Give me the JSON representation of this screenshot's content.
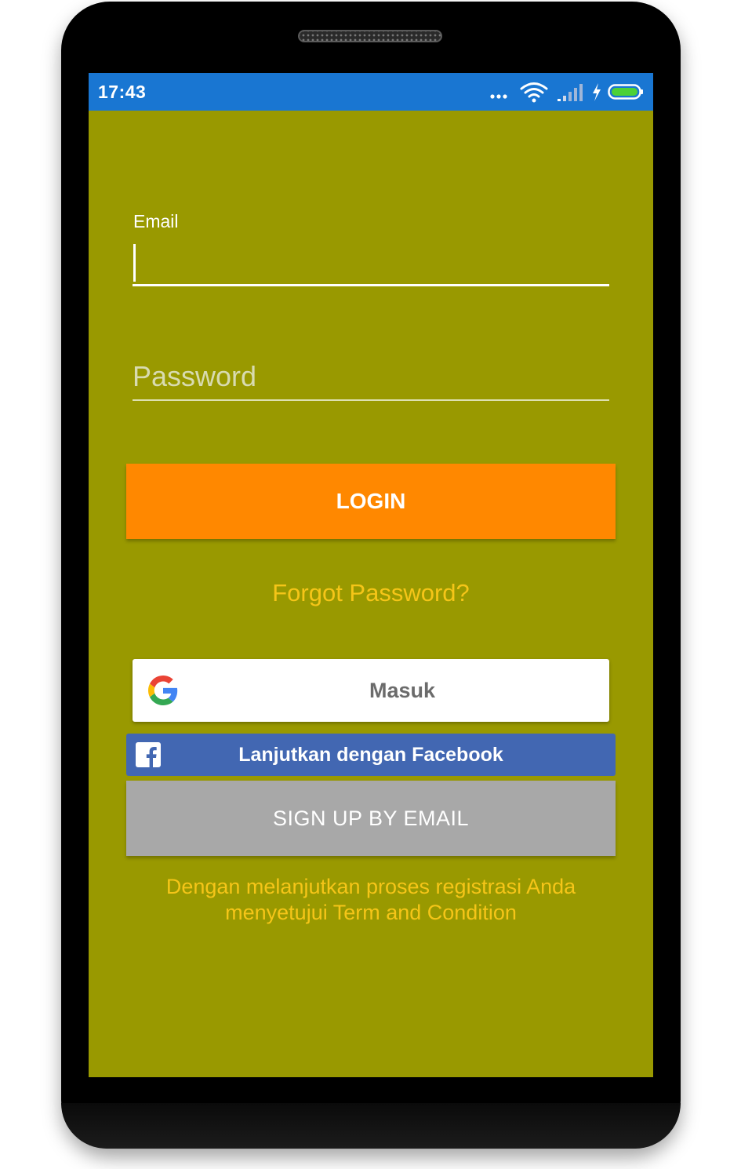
{
  "status_bar": {
    "time": "17:43",
    "icons": [
      "more-dots-icon",
      "wifi-icon",
      "signal-icon",
      "charging-icon",
      "battery-icon"
    ],
    "color": "#1976D2"
  },
  "login_form": {
    "email_label": "Email",
    "email_value": "",
    "password_placeholder": "Password",
    "login_button_label": "LOGIN",
    "forgot_password_label": "Forgot Password?"
  },
  "social": {
    "google_button_label": "Masuk",
    "facebook_button_label": "Lanjutkan dengan Facebook"
  },
  "signup": {
    "button_label": "SIGN UP BY EMAIL"
  },
  "terms": {
    "line1": "Dengan melanjutkan proses registrasi Anda",
    "line2": "menyetujui Term and Condition"
  },
  "colors": {
    "background": "#999900",
    "accent": "#FF8800",
    "link": "#F5C518",
    "facebook": "#4267B2",
    "signup": "#A8A8A8"
  }
}
